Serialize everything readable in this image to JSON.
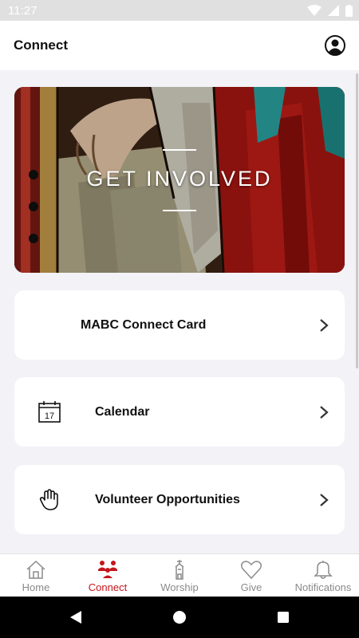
{
  "status_bar": {
    "time": "11:27"
  },
  "header": {
    "title": "Connect"
  },
  "hero": {
    "title": "GET INVOLVED"
  },
  "cards": [
    {
      "label": "MABC Connect Card",
      "icon": "none"
    },
    {
      "label": "Calendar",
      "icon": "calendar-icon",
      "calendar_day": "17"
    },
    {
      "label": "Volunteer Opportunities",
      "icon": "hand-icon"
    }
  ],
  "nav": {
    "items": [
      {
        "label": "Home",
        "icon": "home-icon"
      },
      {
        "label": "Connect",
        "icon": "people-icon"
      },
      {
        "label": "Worship",
        "icon": "church-icon"
      },
      {
        "label": "Give",
        "icon": "heart-icon"
      },
      {
        "label": "Notifications",
        "icon": "bell-icon"
      }
    ],
    "active": "Connect"
  },
  "colors": {
    "accent": "#c4161c",
    "background": "#f2f2f7",
    "card": "#ffffff"
  }
}
